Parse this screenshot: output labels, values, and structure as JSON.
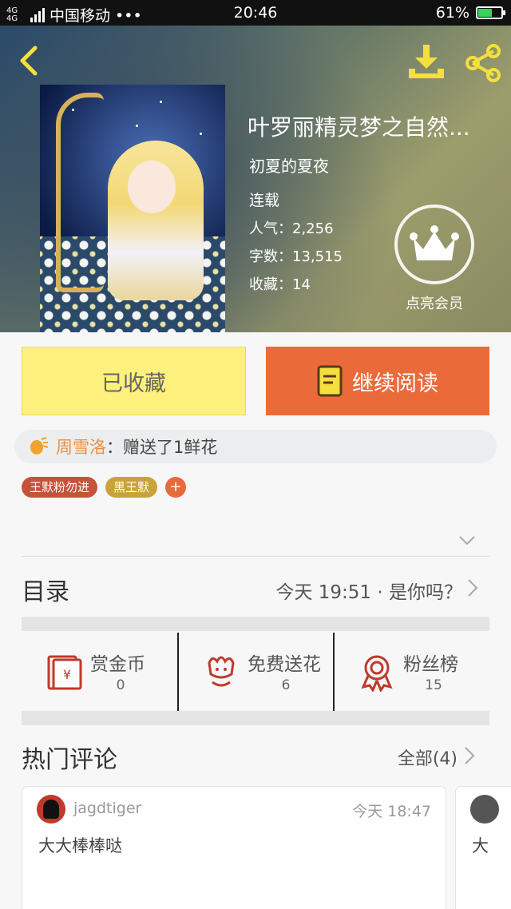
{
  "status_bar": {
    "network": "4G 4G",
    "carrier": "中国移动 •••",
    "time": "20:46",
    "battery": "61%"
  },
  "book": {
    "title": "叶罗丽精灵梦之自然...",
    "author": "初夏的夏夜",
    "status": "连载",
    "popularity_label": "人气：",
    "popularity": "2,256",
    "words_label": "字数：",
    "words": "13,515",
    "favorites_label": "收藏：",
    "favorites": "14"
  },
  "vip": {
    "label": "点亮会员"
  },
  "actions": {
    "favorite_label": "已收藏",
    "read_label": "继续阅读"
  },
  "gift": {
    "user": "周雪洛",
    "text": "：赠送了1鲜花"
  },
  "tags": [
    "王默粉勿进",
    "黑王默",
    "+"
  ],
  "toc": {
    "label": "目录",
    "latest": "今天 19:51 · 是你吗？"
  },
  "rewards": [
    {
      "name": "赏金币",
      "count": "0"
    },
    {
      "name": "免费送花",
      "count": "6"
    },
    {
      "name": "粉丝榜",
      "count": "15"
    }
  ],
  "comments_section": {
    "label": "热门评论",
    "all": "全部(4)"
  },
  "comments": [
    {
      "user": "jagdtiger",
      "time": "今天 18:47",
      "text": "大大棒棒哒"
    },
    {
      "text": "大"
    }
  ],
  "colors": {
    "read_button": "#ea6a3a",
    "favorite_button": "#fdf07c",
    "icon_red": "#c0392b",
    "accent_yellow": "#f5df3e"
  }
}
